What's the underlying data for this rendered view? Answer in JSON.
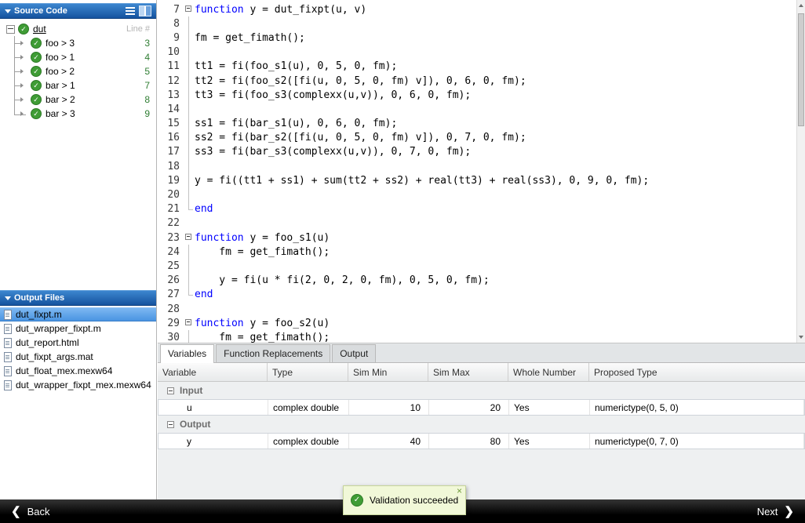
{
  "source_code_panel": {
    "title": "Source Code",
    "root_label": "dut",
    "line_header": "Line #",
    "items": [
      {
        "label": "foo > 3",
        "line": "3"
      },
      {
        "label": "foo > 1",
        "line": "4"
      },
      {
        "label": "foo > 2",
        "line": "5"
      },
      {
        "label": "bar > 1",
        "line": "7"
      },
      {
        "label": "bar > 2",
        "line": "8"
      },
      {
        "label": "bar > 3",
        "line": "9"
      }
    ]
  },
  "output_files_panel": {
    "title": "Output Files",
    "files": [
      {
        "label": "dut_fixpt.m",
        "selected": true
      },
      {
        "label": "dut_wrapper_fixpt.m",
        "selected": false
      },
      {
        "label": "dut_report.html",
        "selected": false
      },
      {
        "label": "dut_fixpt_args.mat",
        "selected": false
      },
      {
        "label": "dut_float_mex.mexw64",
        "selected": false
      },
      {
        "label": "dut_wrapper_fixpt_mex.mexw64",
        "selected": false
      }
    ]
  },
  "editor": {
    "lines": [
      {
        "n": "7",
        "fold": "minus",
        "segs": [
          {
            "c": "kw",
            "t": "function"
          },
          {
            "c": "",
            "t": " y = dut_fixpt(u, v)"
          }
        ]
      },
      {
        "n": "8",
        "fold": "line",
        "segs": []
      },
      {
        "n": "9",
        "fold": "line",
        "segs": [
          {
            "c": "",
            "t": "fm = get_fimath();"
          }
        ]
      },
      {
        "n": "10",
        "fold": "line",
        "segs": []
      },
      {
        "n": "11",
        "fold": "line",
        "segs": [
          {
            "c": "",
            "t": "tt1 = fi(foo_s1(u), 0, 5, 0, fm);"
          }
        ]
      },
      {
        "n": "12",
        "fold": "line",
        "segs": [
          {
            "c": "",
            "t": "tt2 = fi(foo_s2([fi(u, 0, 5, 0, fm) v]), 0, 6, 0, fm);"
          }
        ]
      },
      {
        "n": "13",
        "fold": "line",
        "segs": [
          {
            "c": "",
            "t": "tt3 = fi(foo_s3(complexx(u,v)), 0, 6, 0, fm);"
          }
        ]
      },
      {
        "n": "14",
        "fold": "line",
        "segs": []
      },
      {
        "n": "15",
        "fold": "line",
        "segs": [
          {
            "c": "",
            "t": "ss1 = fi(bar_s1(u), 0, 6, 0, fm);"
          }
        ]
      },
      {
        "n": "16",
        "fold": "line",
        "segs": [
          {
            "c": "",
            "t": "ss2 = fi(bar_s2([fi(u, 0, 5, 0, fm) v]), 0, 7, 0, fm);"
          }
        ]
      },
      {
        "n": "17",
        "fold": "line",
        "segs": [
          {
            "c": "",
            "t": "ss3 = fi(bar_s3(complexx(u,v)), 0, 7, 0, fm);"
          }
        ]
      },
      {
        "n": "18",
        "fold": "line",
        "segs": []
      },
      {
        "n": "19",
        "fold": "line",
        "segs": [
          {
            "c": "",
            "t": "y = fi((tt1 + ss1) + sum(tt2 + ss2) + real(tt3) + real(ss3), 0, 9, 0, fm);"
          }
        ]
      },
      {
        "n": "20",
        "fold": "line",
        "segs": []
      },
      {
        "n": "21",
        "fold": "end",
        "segs": [
          {
            "c": "kw",
            "t": "end"
          }
        ]
      },
      {
        "n": "22",
        "fold": "",
        "segs": []
      },
      {
        "n": "23",
        "fold": "minus",
        "segs": [
          {
            "c": "kw",
            "t": "function"
          },
          {
            "c": "",
            "t": " y = foo_s1(u)"
          }
        ]
      },
      {
        "n": "24",
        "fold": "line",
        "segs": [
          {
            "c": "",
            "t": "    fm = get_fimath();"
          }
        ]
      },
      {
        "n": "25",
        "fold": "line",
        "segs": []
      },
      {
        "n": "26",
        "fold": "line",
        "segs": [
          {
            "c": "",
            "t": "    y = fi(u * fi(2, 0, 2, 0, fm), 0, 5, 0, fm);"
          }
        ]
      },
      {
        "n": "27",
        "fold": "end",
        "segs": [
          {
            "c": "kw",
            "t": "end"
          }
        ]
      },
      {
        "n": "28",
        "fold": "",
        "segs": []
      },
      {
        "n": "29",
        "fold": "minus",
        "segs": [
          {
            "c": "kw",
            "t": "function"
          },
          {
            "c": "",
            "t": " y = foo_s2(u)"
          }
        ]
      },
      {
        "n": "30",
        "fold": "line",
        "segs": [
          {
            "c": "",
            "t": "    fm = get_fimath();"
          }
        ]
      }
    ]
  },
  "bottom_panel": {
    "tabs": [
      "Variables",
      "Function Replacements",
      "Output"
    ],
    "active_tab": "Variables",
    "columns": [
      "Variable",
      "Type",
      "Sim Min",
      "Sim Max",
      "Whole Number",
      "Proposed Type"
    ],
    "groups": [
      {
        "name": "Input",
        "rows": [
          [
            "u",
            "complex double",
            "10",
            "20",
            "Yes",
            "numerictype(0, 5, 0)"
          ]
        ]
      },
      {
        "name": "Output",
        "rows": [
          [
            "y",
            "complex double",
            "40",
            "80",
            "Yes",
            "numerictype(0, 7, 0)"
          ]
        ]
      }
    ]
  },
  "footer": {
    "back_label": "Back",
    "next_label": "Next"
  },
  "notification": {
    "message": "Validation succeeded"
  },
  "icons": {
    "panel_collapse": "triangle-down-icon",
    "source_status": "check-icon",
    "file": "file-icon",
    "fold": "fold-minus-icon",
    "back": "chevron-left-icon",
    "next": "chevron-right-icon",
    "toast_status": "check-icon",
    "toast_close": "close-icon"
  },
  "colors": {
    "panel_header_blue": "#2a6fc2",
    "keyword_blue": "#0000ff",
    "status_green": "#3f9c35",
    "selection_blue": "#5a9fe5",
    "line_number_green": "#2e7d32",
    "toast_background": "#f1f8d8",
    "footer_black": "#000000"
  }
}
